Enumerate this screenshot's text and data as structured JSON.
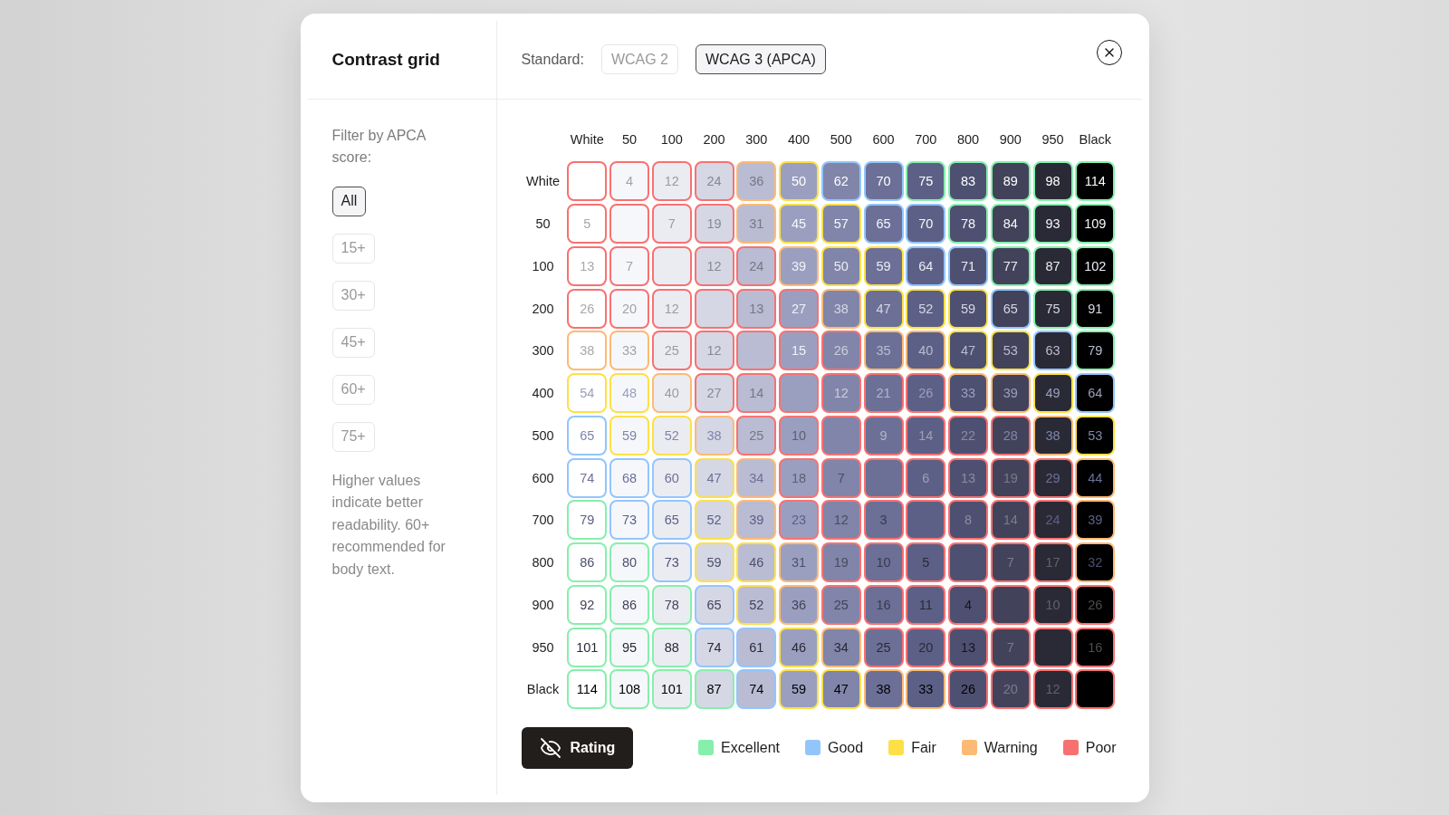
{
  "dialog": {
    "title": "Contrast grid"
  },
  "standard": {
    "label": "Standard:",
    "options": [
      {
        "label": "WCAG 2",
        "selected": false
      },
      {
        "label": "WCAG 3 (APCA)",
        "selected": true
      }
    ]
  },
  "filter": {
    "label": "Filter by APCA score:",
    "options": [
      {
        "label": "All",
        "selected": true
      },
      {
        "label": "15+",
        "selected": false
      },
      {
        "label": "30+",
        "selected": false
      },
      {
        "label": "45+",
        "selected": false
      },
      {
        "label": "60+",
        "selected": false
      },
      {
        "label": "75+",
        "selected": false
      }
    ],
    "note": "Higher values indicate better readability. 60+ recommended for body text."
  },
  "grid": {
    "columns": [
      "White",
      "50",
      "100",
      "200",
      "300",
      "400",
      "500",
      "600",
      "700",
      "800",
      "900",
      "950",
      "Black"
    ],
    "rows": [
      {
        "label": "White",
        "cells": [
          {
            "color": "#f87171"
          },
          {
            "value": "4",
            "color": "#f87171"
          },
          {
            "value": "12",
            "color": "#f87171"
          },
          {
            "value": "24",
            "color": "#f87171"
          },
          {
            "value": "36",
            "color": "#fdba74"
          },
          {
            "value": "50",
            "color": "#fde047"
          },
          {
            "value": "62",
            "color": "#93c5fd"
          },
          {
            "value": "70",
            "color": "#93c5fd"
          },
          {
            "value": "75",
            "color": "#86efac"
          },
          {
            "value": "83",
            "color": "#86efac"
          },
          {
            "value": "89",
            "color": "#86efac"
          },
          {
            "value": "98",
            "color": "#86efac"
          },
          {
            "value": "114",
            "color": "#86efac"
          }
        ]
      },
      {
        "label": "50",
        "cells": [
          {
            "value": "5",
            "color": "#f87171"
          },
          {
            "color": "#f87171"
          },
          {
            "value": "7",
            "color": "#f87171"
          },
          {
            "value": "19",
            "color": "#f87171"
          },
          {
            "value": "31",
            "color": "#fdba74"
          },
          {
            "value": "45",
            "color": "#fde047"
          },
          {
            "value": "57",
            "color": "#fde047"
          },
          {
            "value": "65",
            "color": "#93c5fd"
          },
          {
            "value": "70",
            "color": "#93c5fd"
          },
          {
            "value": "78",
            "color": "#86efac"
          },
          {
            "value": "84",
            "color": "#86efac"
          },
          {
            "value": "93",
            "color": "#86efac"
          },
          {
            "value": "109",
            "color": "#86efac"
          }
        ]
      },
      {
        "label": "100",
        "cells": [
          {
            "value": "13",
            "color": "#f87171"
          },
          {
            "value": "7",
            "color": "#f87171"
          },
          {
            "color": "#f87171"
          },
          {
            "value": "12",
            "color": "#f87171"
          },
          {
            "value": "24",
            "color": "#f87171"
          },
          {
            "value": "39",
            "color": "#fdba74"
          },
          {
            "value": "50",
            "color": "#fde047"
          },
          {
            "value": "59",
            "color": "#fde047"
          },
          {
            "value": "64",
            "color": "#93c5fd"
          },
          {
            "value": "71",
            "color": "#93c5fd"
          },
          {
            "value": "77",
            "color": "#86efac"
          },
          {
            "value": "87",
            "color": "#86efac"
          },
          {
            "value": "102",
            "color": "#86efac"
          }
        ]
      },
      {
        "label": "200",
        "cells": [
          {
            "value": "26",
            "color": "#f87171"
          },
          {
            "value": "20",
            "color": "#f87171"
          },
          {
            "value": "12",
            "color": "#f87171"
          },
          {
            "color": "#f87171"
          },
          {
            "value": "13",
            "color": "#f87171"
          },
          {
            "value": "27",
            "color": "#f87171"
          },
          {
            "value": "38",
            "color": "#fdba74"
          },
          {
            "value": "47",
            "color": "#fde047"
          },
          {
            "value": "52",
            "color": "#fde047"
          },
          {
            "value": "59",
            "color": "#fde047"
          },
          {
            "value": "65",
            "color": "#93c5fd"
          },
          {
            "value": "75",
            "color": "#86efac"
          },
          {
            "value": "91",
            "color": "#86efac"
          }
        ]
      },
      {
        "label": "300",
        "cells": [
          {
            "value": "38",
            "color": "#fdba74"
          },
          {
            "value": "33",
            "color": "#fdba74"
          },
          {
            "value": "25",
            "color": "#f87171"
          },
          {
            "value": "12",
            "color": "#f87171"
          },
          {
            "color": "#f87171"
          },
          {
            "value": "15",
            "color": "#f87171"
          },
          {
            "value": "26",
            "color": "#f87171"
          },
          {
            "value": "35",
            "color": "#fdba74"
          },
          {
            "value": "40",
            "color": "#fdba74"
          },
          {
            "value": "47",
            "color": "#fde047"
          },
          {
            "value": "53",
            "color": "#fde047"
          },
          {
            "value": "63",
            "color": "#93c5fd"
          },
          {
            "value": "79",
            "color": "#86efac"
          }
        ]
      },
      {
        "label": "400",
        "cells": [
          {
            "value": "54",
            "color": "#fde047"
          },
          {
            "value": "48",
            "color": "#fde047"
          },
          {
            "value": "40",
            "color": "#fdba74"
          },
          {
            "value": "27",
            "color": "#f87171"
          },
          {
            "value": "14",
            "color": "#f87171"
          },
          {
            "color": "#f87171"
          },
          {
            "value": "12",
            "color": "#f87171"
          },
          {
            "value": "21",
            "color": "#f87171"
          },
          {
            "value": "26",
            "color": "#f87171"
          },
          {
            "value": "33",
            "color": "#fdba74"
          },
          {
            "value": "39",
            "color": "#fdba74"
          },
          {
            "value": "49",
            "color": "#fde047"
          },
          {
            "value": "64",
            "color": "#93c5fd"
          }
        ]
      },
      {
        "label": "500",
        "cells": [
          {
            "value": "65",
            "color": "#93c5fd"
          },
          {
            "value": "59",
            "color": "#fde047"
          },
          {
            "value": "52",
            "color": "#fde047"
          },
          {
            "value": "38",
            "color": "#fdba74"
          },
          {
            "value": "25",
            "color": "#f87171"
          },
          {
            "value": "10",
            "color": "#f87171"
          },
          {
            "color": "#f87171"
          },
          {
            "value": "9",
            "color": "#f87171"
          },
          {
            "value": "14",
            "color": "#f87171"
          },
          {
            "value": "22",
            "color": "#f87171"
          },
          {
            "value": "28",
            "color": "#f87171"
          },
          {
            "value": "38",
            "color": "#fdba74"
          },
          {
            "value": "53",
            "color": "#fde047"
          }
        ]
      },
      {
        "label": "600",
        "cells": [
          {
            "value": "74",
            "color": "#93c5fd"
          },
          {
            "value": "68",
            "color": "#93c5fd"
          },
          {
            "value": "60",
            "color": "#93c5fd"
          },
          {
            "value": "47",
            "color": "#fde047"
          },
          {
            "value": "34",
            "color": "#fdba74"
          },
          {
            "value": "18",
            "color": "#f87171"
          },
          {
            "value": "7",
            "color": "#f87171"
          },
          {
            "color": "#f87171"
          },
          {
            "value": "6",
            "color": "#f87171"
          },
          {
            "value": "13",
            "color": "#f87171"
          },
          {
            "value": "19",
            "color": "#f87171"
          },
          {
            "value": "29",
            "color": "#f87171"
          },
          {
            "value": "44",
            "color": "#fdba74"
          }
        ]
      },
      {
        "label": "700",
        "cells": [
          {
            "value": "79",
            "color": "#86efac"
          },
          {
            "value": "73",
            "color": "#93c5fd"
          },
          {
            "value": "65",
            "color": "#93c5fd"
          },
          {
            "value": "52",
            "color": "#fde047"
          },
          {
            "value": "39",
            "color": "#fdba74"
          },
          {
            "value": "23",
            "color": "#f87171"
          },
          {
            "value": "12",
            "color": "#f87171"
          },
          {
            "value": "3",
            "color": "#f87171"
          },
          {
            "color": "#f87171"
          },
          {
            "value": "8",
            "color": "#f87171"
          },
          {
            "value": "14",
            "color": "#f87171"
          },
          {
            "value": "24",
            "color": "#f87171"
          },
          {
            "value": "39",
            "color": "#fdba74"
          }
        ]
      },
      {
        "label": "800",
        "cells": [
          {
            "value": "86",
            "color": "#86efac"
          },
          {
            "value": "80",
            "color": "#86efac"
          },
          {
            "value": "73",
            "color": "#93c5fd"
          },
          {
            "value": "59",
            "color": "#fde047"
          },
          {
            "value": "46",
            "color": "#fde047"
          },
          {
            "value": "31",
            "color": "#fdba74"
          },
          {
            "value": "19",
            "color": "#f87171"
          },
          {
            "value": "10",
            "color": "#f87171"
          },
          {
            "value": "5",
            "color": "#f87171"
          },
          {
            "color": "#f87171"
          },
          {
            "value": "7",
            "color": "#f87171"
          },
          {
            "value": "17",
            "color": "#f87171"
          },
          {
            "value": "32",
            "color": "#fdba74"
          }
        ]
      },
      {
        "label": "900",
        "cells": [
          {
            "value": "92",
            "color": "#86efac"
          },
          {
            "value": "86",
            "color": "#86efac"
          },
          {
            "value": "78",
            "color": "#86efac"
          },
          {
            "value": "65",
            "color": "#93c5fd"
          },
          {
            "value": "52",
            "color": "#fde047"
          },
          {
            "value": "36",
            "color": "#fdba74"
          },
          {
            "value": "25",
            "color": "#f87171"
          },
          {
            "value": "16",
            "color": "#f87171"
          },
          {
            "value": "11",
            "color": "#f87171"
          },
          {
            "value": "4",
            "color": "#f87171"
          },
          {
            "color": "#f87171"
          },
          {
            "value": "10",
            "color": "#f87171"
          },
          {
            "value": "26",
            "color": "#f87171"
          }
        ]
      },
      {
        "label": "950",
        "cells": [
          {
            "value": "101",
            "color": "#86efac"
          },
          {
            "value": "95",
            "color": "#86efac"
          },
          {
            "value": "88",
            "color": "#86efac"
          },
          {
            "value": "74",
            "color": "#93c5fd"
          },
          {
            "value": "61",
            "color": "#93c5fd"
          },
          {
            "value": "46",
            "color": "#fde047"
          },
          {
            "value": "34",
            "color": "#fdba74"
          },
          {
            "value": "25",
            "color": "#f87171"
          },
          {
            "value": "20",
            "color": "#f87171"
          },
          {
            "value": "13",
            "color": "#f87171"
          },
          {
            "value": "7",
            "color": "#f87171"
          },
          {
            "color": "#f87171"
          },
          {
            "value": "16",
            "color": "#f87171"
          }
        ]
      },
      {
        "label": "Black",
        "cells": [
          {
            "value": "114",
            "color": "#86efac"
          },
          {
            "value": "108",
            "color": "#86efac"
          },
          {
            "value": "101",
            "color": "#86efac"
          },
          {
            "value": "87",
            "color": "#86efac"
          },
          {
            "value": "74",
            "color": "#93c5fd"
          },
          {
            "value": "59",
            "color": "#fde047"
          },
          {
            "value": "47",
            "color": "#fde047"
          },
          {
            "value": "38",
            "color": "#fdba74"
          },
          {
            "value": "33",
            "color": "#fdba74"
          },
          {
            "value": "26",
            "color": "#f87171"
          },
          {
            "value": "20",
            "color": "#f87171"
          },
          {
            "value": "12",
            "color": "#f87171"
          },
          {
            "color": "#f87171"
          }
        ]
      }
    ]
  },
  "rating_button": {
    "label": "Rating"
  },
  "legend": [
    {
      "label": "Excellent",
      "color": "#86efac"
    },
    {
      "label": "Good",
      "color": "#93c5fd"
    },
    {
      "label": "Fair",
      "color": "#fde047"
    },
    {
      "label": "Warning",
      "color": "#fdba74"
    },
    {
      "label": "Poor",
      "color": "#f87171"
    }
  ]
}
